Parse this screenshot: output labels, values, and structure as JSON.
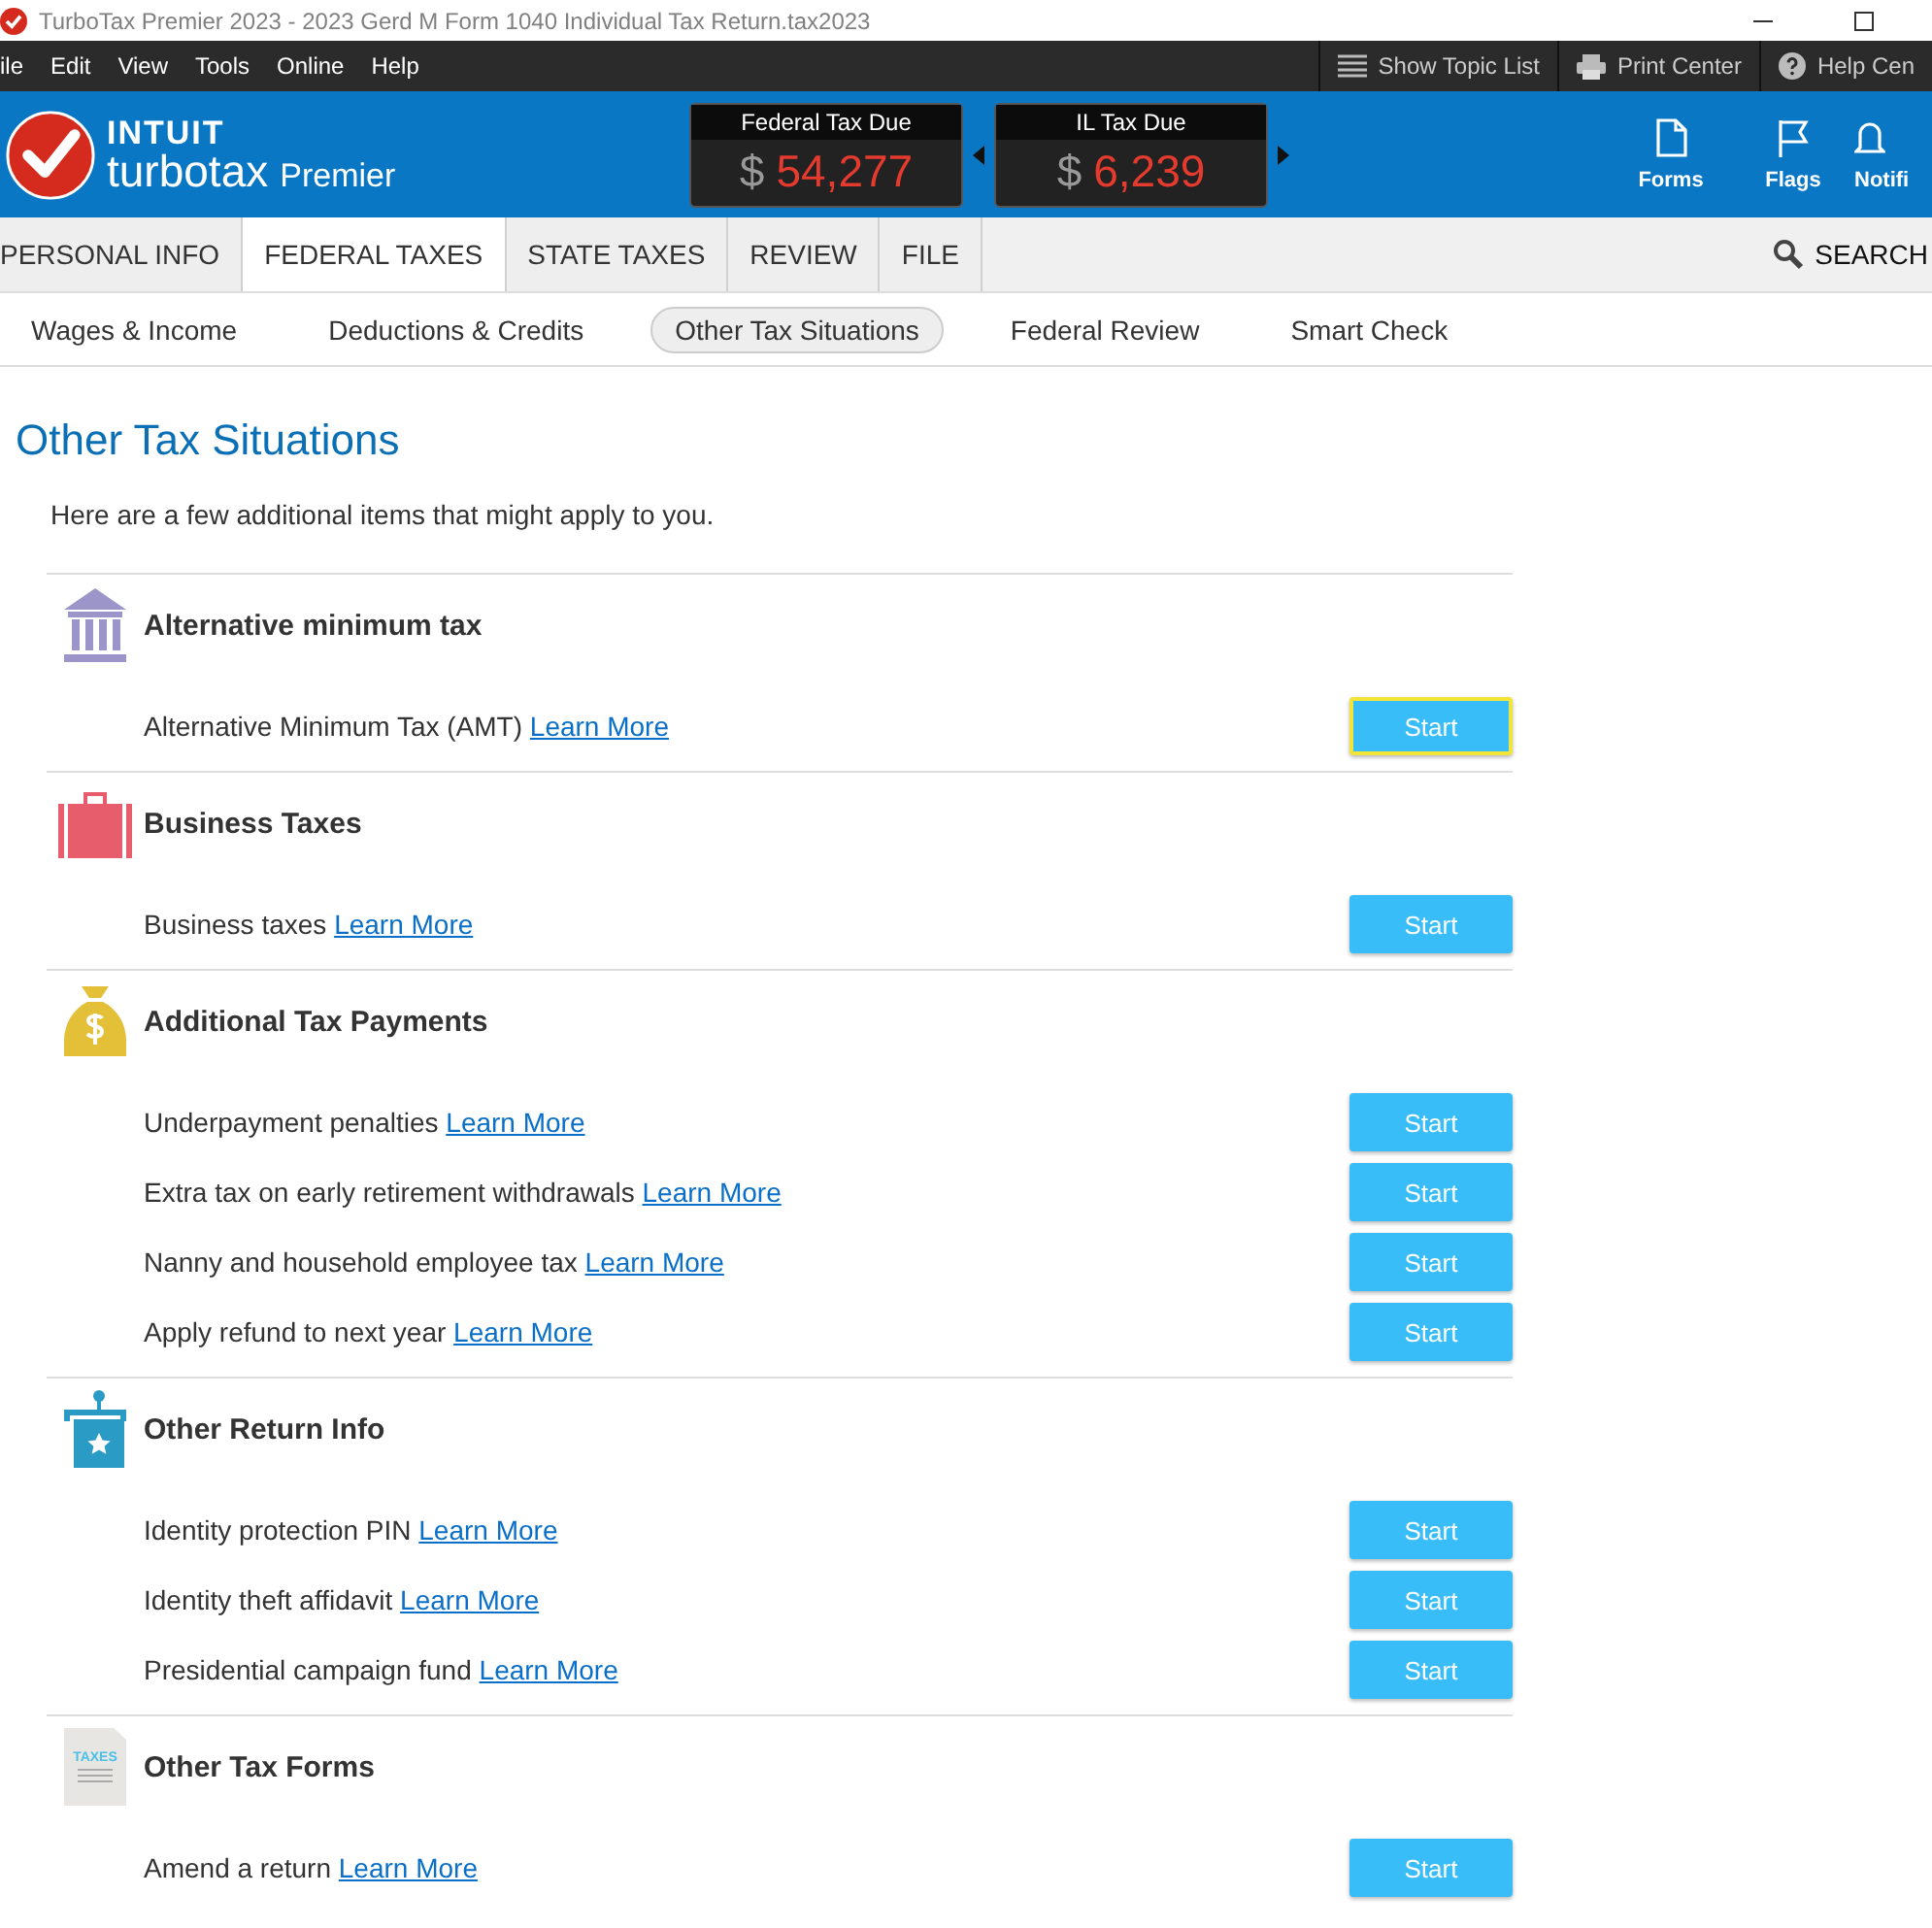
{
  "window": {
    "title": "TurboTax Premier 2023 - 2023 Gerd M Form 1040  Individual Tax Return.tax2023"
  },
  "menu": [
    "ile",
    "Edit",
    "View",
    "Tools",
    "Online",
    "Help"
  ],
  "toolbar": [
    {
      "kind": "list",
      "label": "Show Topic List"
    },
    {
      "kind": "print",
      "label": "Print Center"
    },
    {
      "kind": "help",
      "label": "Help Cen"
    }
  ],
  "brand": {
    "company": "INTUIT",
    "product": "turbotax",
    "edition": "Premier"
  },
  "tax_due": [
    {
      "label": "Federal Tax Due",
      "currency": "$",
      "amount": "54,277"
    },
    {
      "label": "IL Tax Due",
      "currency": "$",
      "amount": "6,239"
    }
  ],
  "header_buttons": [
    {
      "kind": "forms",
      "label": "Forms"
    },
    {
      "kind": "flags",
      "label": "Flags"
    },
    {
      "kind": "bell",
      "label": "Notifi"
    }
  ],
  "tabs": [
    {
      "label": "PERSONAL INFO",
      "selected": false
    },
    {
      "label": "FEDERAL TAXES",
      "selected": true
    },
    {
      "label": "STATE TAXES",
      "selected": false
    },
    {
      "label": "REVIEW",
      "selected": false
    },
    {
      "label": "FILE",
      "selected": false
    }
  ],
  "search": {
    "label": "SEARCH"
  },
  "subtabs": [
    {
      "label": "Wages & Income",
      "selected": false
    },
    {
      "label": "Deductions & Credits",
      "selected": false
    },
    {
      "label": "Other Tax Situations",
      "selected": true
    },
    {
      "label": "Federal Review",
      "selected": false
    },
    {
      "label": "Smart Check",
      "selected": false
    }
  ],
  "page": {
    "title": "Other Tax Situations",
    "intro": "Here are a few additional items that might apply to you."
  },
  "sections": [
    {
      "kind": "bank",
      "title": "Alternative minimum tax",
      "items": [
        {
          "text": "Alternative Minimum Tax (AMT)",
          "link": "Learn More",
          "button": "Start",
          "focused": true
        }
      ]
    },
    {
      "kind": "briefcase",
      "title": "Business Taxes",
      "items": [
        {
          "text": "Business taxes",
          "link": "Learn More",
          "button": "Start",
          "focused": false
        }
      ]
    },
    {
      "kind": "moneybag",
      "title": "Additional Tax Payments",
      "items": [
        {
          "text": "Underpayment penalties",
          "link": "Learn More",
          "button": "Start",
          "focused": false
        },
        {
          "text": "Extra tax on early retirement withdrawals",
          "link": "Learn More",
          "button": "Start",
          "focused": false
        },
        {
          "text": "Nanny and household employee tax",
          "link": "Learn More",
          "button": "Start",
          "focused": false
        },
        {
          "text": "Apply refund to next year",
          "link": "Learn More",
          "button": "Start",
          "focused": false
        }
      ]
    },
    {
      "kind": "ballot",
      "title": "Other Return Info",
      "items": [
        {
          "text": "Identity protection PIN",
          "link": "Learn More",
          "button": "Start",
          "focused": false
        },
        {
          "text": "Identity theft affidavit",
          "link": "Learn More",
          "button": "Start",
          "focused": false
        },
        {
          "text": "Presidential campaign fund",
          "link": "Learn More",
          "button": "Start",
          "focused": false
        }
      ]
    },
    {
      "kind": "document",
      "icon_label": "TAXES",
      "title": "Other Tax Forms",
      "items": [
        {
          "text": "Amend a return",
          "link": "Learn More",
          "button": "Start",
          "focused": false
        }
      ]
    }
  ]
}
